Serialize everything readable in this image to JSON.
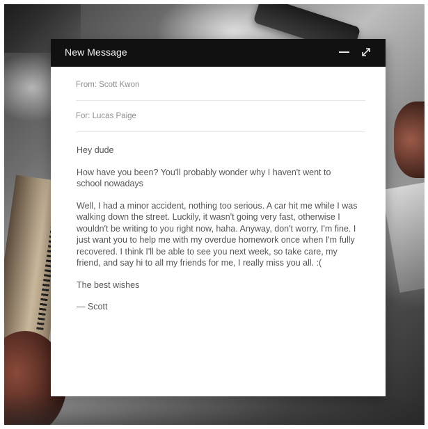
{
  "window": {
    "title": "New Message",
    "minimize_icon": "minimize-icon",
    "expand_icon": "expand-icon"
  },
  "message": {
    "from": "From: Scott Kwon",
    "for": "For: Lucas Paige",
    "greeting": "Hey dude",
    "paragraph_1": "How have you been? You'll probably wonder why I haven't went to school nowadays",
    "paragraph_2": "Well, I had a minor accident, nothing too serious. A car hit me while I was walking down the street. Luckily, it wasn't going very fast, otherwise I wouldn't be writing to you right now, haha. Anyway, don't worry, I'm fine. I just want you to help me with my overdue homework once when I'm fully recovered. I think I'll be able to see you next week, so take care, my friend, and say hi to all my friends for me, I really miss you all. :(",
    "closing": "The best wishes",
    "signature": "— Scott"
  },
  "colors": {
    "titlebar": "#111111",
    "window_bg": "#ffffff",
    "body_text": "#555555",
    "field_text": "#8e8e8e"
  }
}
